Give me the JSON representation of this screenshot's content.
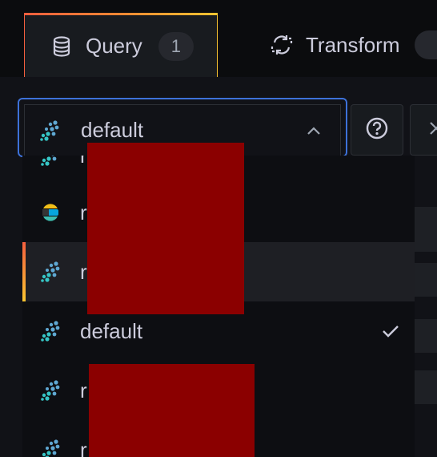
{
  "tabs": [
    {
      "label": "Query",
      "count": "1",
      "icon": "database-icon"
    },
    {
      "label": "Transform",
      "count": "",
      "icon": "transform-icon"
    }
  ],
  "datasource_select": {
    "value": "default",
    "icon": "prometheus-datasource-icon"
  },
  "help_button": {
    "icon": "question-circle-icon"
  },
  "close_button": {
    "icon": "close-icon"
  },
  "options": [
    {
      "label": "r",
      "icon": "prometheus-datasource-icon",
      "state": "partial"
    },
    {
      "label": "r",
      "icon": "elasticsearch-datasource-icon",
      "state": ""
    },
    {
      "label": "r",
      "icon": "prometheus-datasource-icon",
      "state": "active"
    },
    {
      "label": "default",
      "icon": "prometheus-datasource-icon",
      "state": "selected"
    },
    {
      "label": "r",
      "icon": "prometheus-datasource-icon",
      "state": ""
    },
    {
      "label": "r",
      "icon": "prometheus-datasource-icon",
      "state": ""
    }
  ],
  "colors": {
    "accent_blue": "#3d71d9",
    "gradient_start": "#f55f3e",
    "gradient_end": "#fbc531",
    "redaction": "#8b0000"
  }
}
